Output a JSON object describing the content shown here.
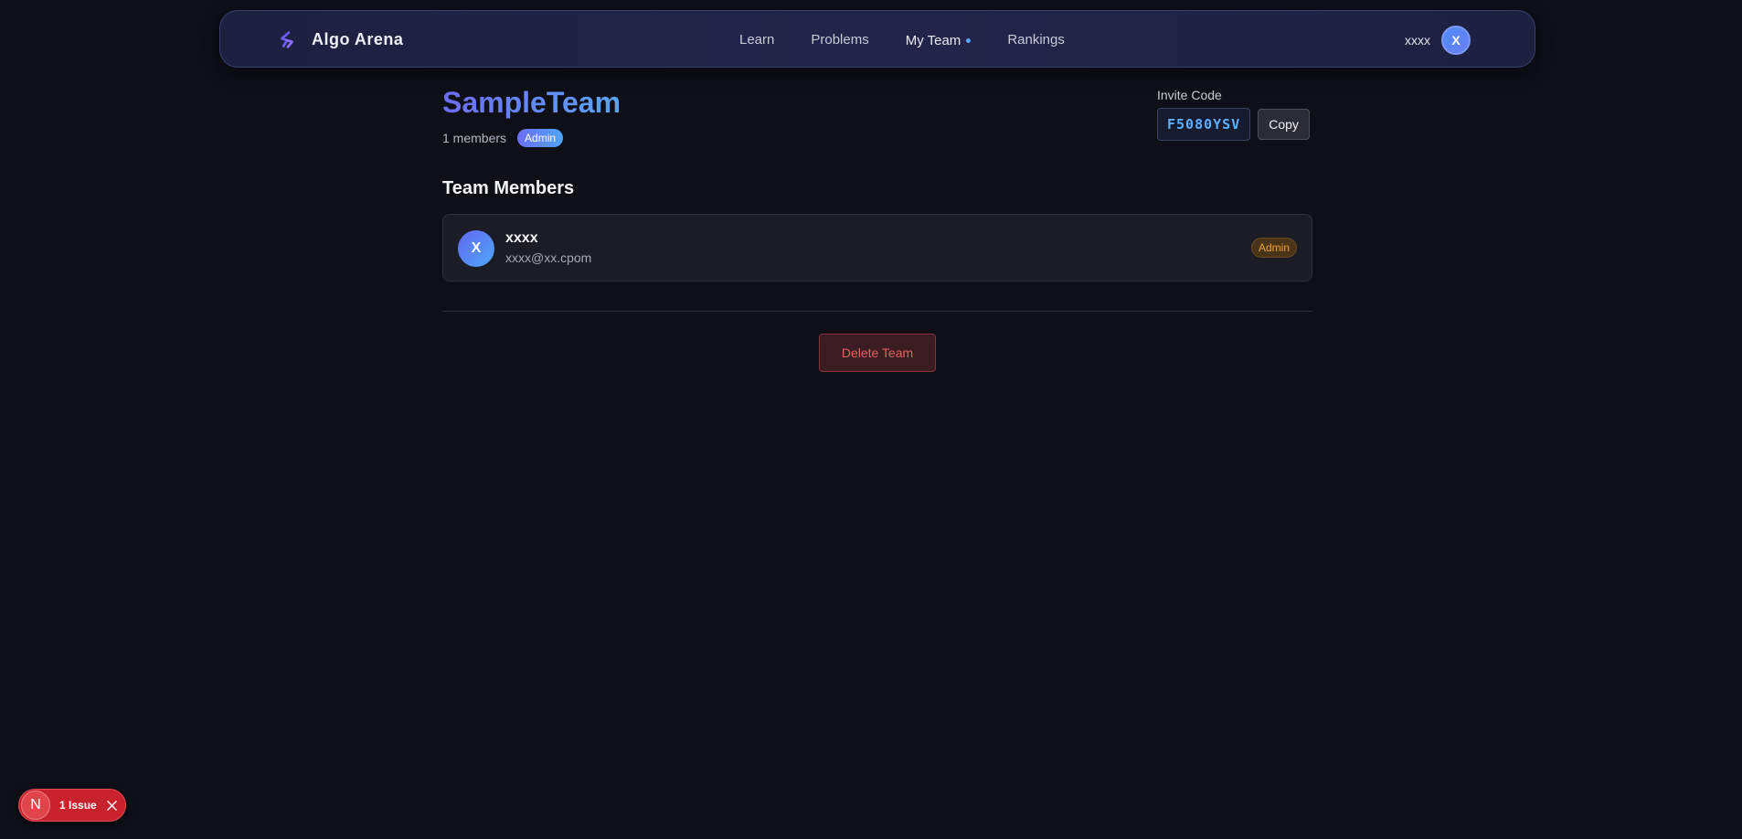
{
  "navbar": {
    "brand": "Algo Arena",
    "links": [
      {
        "label": "Learn"
      },
      {
        "label": "Problems"
      },
      {
        "label": "My Team"
      },
      {
        "label": "Rankings"
      }
    ],
    "active_link": "My Team",
    "user_name": "xxxx",
    "user_initial": "X"
  },
  "team": {
    "name": "SampleTeam",
    "member_count": "1 members",
    "role_badge": "Admin",
    "invite_label": "Invite Code",
    "invite_code": "F5080YSV",
    "copy_label": "Copy"
  },
  "members_section": {
    "title": "Team Members",
    "members": [
      {
        "initial": "X",
        "name": "xxxx",
        "email": "xxxx@xx.cpom",
        "role": "Admin"
      }
    ]
  },
  "actions": {
    "delete_label": "Delete Team"
  },
  "issue_toast": {
    "logo_letter": "N",
    "text": "1 Issue"
  },
  "colors": {
    "background": "#0e0f17",
    "accent_blue": "#5aa5f7",
    "accent_purple": "#6d6cf2",
    "danger": "#ef5d5d",
    "admin_orange": "#f0a23a"
  }
}
